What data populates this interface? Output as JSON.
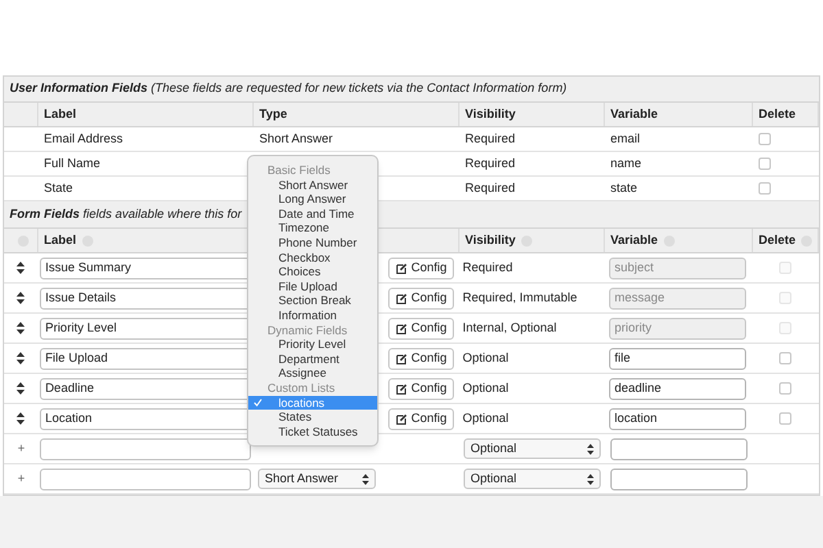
{
  "user_info": {
    "title": "User Information Fields",
    "subtitle": "(These fields are requested for new tickets via the Contact Information form)",
    "columns": [
      "Label",
      "Type",
      "Visibility",
      "Variable",
      "Delete"
    ],
    "rows": [
      {
        "label": "Email Address",
        "type": "Short Answer",
        "visibility": "Required",
        "variable": "email",
        "checked": false
      },
      {
        "label": "Full Name",
        "visibility": "Required",
        "variable": "name",
        "checked": false
      },
      {
        "label": "State",
        "visibility": "Required",
        "variable": "state",
        "checked": false
      }
    ]
  },
  "form_fields": {
    "title": "Form Fields",
    "subtitle": "fields available where this for",
    "columns": [
      "Label",
      "Visibility",
      "Variable",
      "Delete"
    ],
    "rows": [
      {
        "kind": "field",
        "label": "Issue Summary",
        "config": "Config",
        "visibility": "Required",
        "variable": "subject",
        "variable_disabled": true,
        "checked": false,
        "delete_disabled": true
      },
      {
        "kind": "field",
        "label": "Issue Details",
        "config": "Config",
        "visibility": "Required, Immutable",
        "variable": "message",
        "variable_disabled": true,
        "checked": false,
        "delete_disabled": true
      },
      {
        "kind": "field",
        "label": "Priority Level",
        "config": "Config",
        "visibility": "Internal, Optional",
        "variable": "priority",
        "variable_disabled": true,
        "checked": false,
        "delete_disabled": true
      },
      {
        "kind": "field",
        "label": "File Upload",
        "config": "Config",
        "visibility": "Optional",
        "variable": "file",
        "variable_disabled": false,
        "checked": false,
        "delete_disabled": false
      },
      {
        "kind": "field",
        "label": "Deadline",
        "config": "Config",
        "visibility": "Optional",
        "variable": "deadline",
        "variable_disabled": false,
        "checked": false,
        "delete_disabled": false
      },
      {
        "kind": "field",
        "label": "Location",
        "config": "Config",
        "visibility": "Optional",
        "variable": "location",
        "variable_disabled": false,
        "checked": false,
        "delete_disabled": false
      },
      {
        "kind": "new",
        "add": "+",
        "visibility": "Optional"
      },
      {
        "kind": "new",
        "add": "+",
        "type": "Short Answer",
        "visibility": "Optional"
      }
    ]
  },
  "type_menu": {
    "groups": [
      {
        "label": "Basic Fields",
        "items": [
          {
            "label": "Short Answer",
            "selected": false
          },
          {
            "label": "Long Answer",
            "selected": false
          },
          {
            "label": "Date and Time",
            "selected": false
          },
          {
            "label": "Timezone",
            "selected": false
          },
          {
            "label": "Phone Number",
            "selected": false
          },
          {
            "label": "Checkbox",
            "selected": false
          },
          {
            "label": "Choices",
            "selected": false
          },
          {
            "label": "File Upload",
            "selected": false
          },
          {
            "label": "Section Break",
            "selected": false
          },
          {
            "label": "Information",
            "selected": false
          }
        ]
      },
      {
        "label": "Dynamic Fields",
        "items": [
          {
            "label": "Priority Level",
            "selected": false
          },
          {
            "label": "Department",
            "selected": false
          },
          {
            "label": "Assignee",
            "selected": false
          }
        ]
      },
      {
        "label": "Custom Lists",
        "items": [
          {
            "label": "locations",
            "selected": true
          },
          {
            "label": "States",
            "selected": false
          },
          {
            "label": "Ticket Statuses",
            "selected": false
          }
        ]
      }
    ]
  }
}
